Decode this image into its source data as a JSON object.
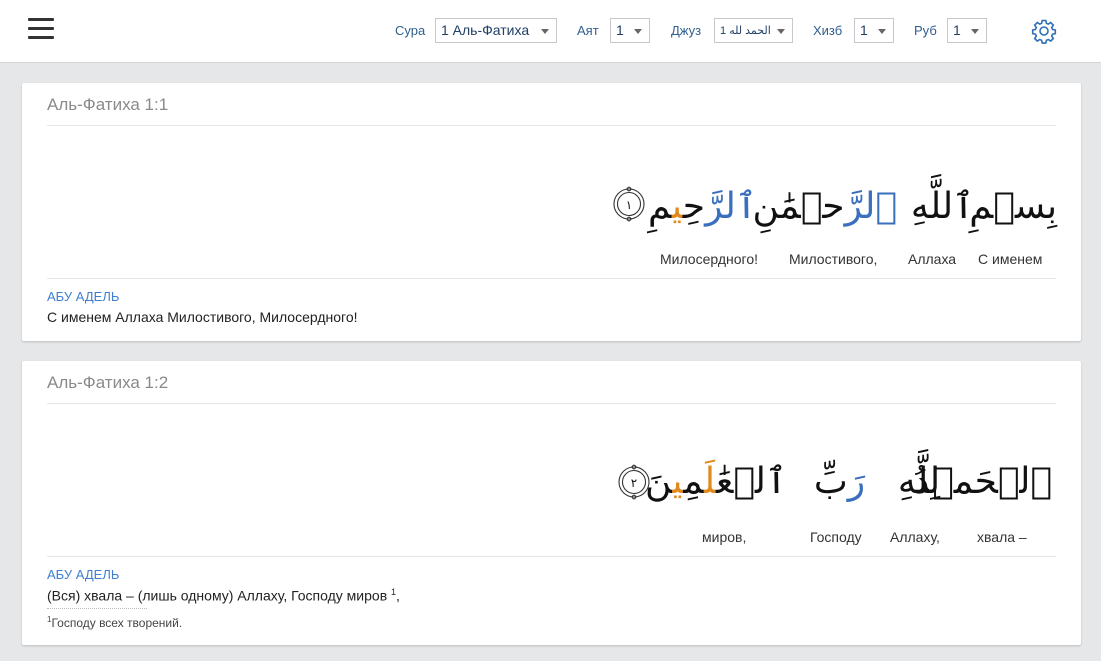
{
  "header": {
    "surah_label": "Сура",
    "surah_value": "1 Аль-Фатиха",
    "ayah_label": "Аят",
    "ayah_value": "1",
    "juz_label": "Джуз",
    "juz_value": "1 الحمد لله",
    "hizb_label": "Хизб",
    "hizb_value": "1",
    "rub_label": "Руб",
    "rub_value": "1",
    "icons": {
      "menu": "hamburger-menu-icon",
      "settings": "gear-icon"
    }
  },
  "verses": [
    {
      "title": "Аль-Фатиха 1:1",
      "ayah_number": "١",
      "words": [
        {
          "ar": "بِسۡمِ",
          "tr": "С именем"
        },
        {
          "ar": "ٱللَّهِ",
          "tr": "Аллаха"
        },
        {
          "ar": "ٱلرَّحۡمَٰنِ",
          "tr": "Милостивого,"
        },
        {
          "ar": "ٱلرَّحِيمِ",
          "tr": "Милосердного!"
        }
      ],
      "translator": "Абу Адель",
      "translation": "С именем Аллаха Милостивого, Милосердного!"
    },
    {
      "title": "Аль-Фатиха 1:2",
      "ayah_number": "٢",
      "words": [
        {
          "ar": "ٱلۡحَمۡدُ",
          "tr": "хвала –"
        },
        {
          "ar": "لِلَّهِ",
          "tr": "Аллаху,"
        },
        {
          "ar": "رَبِّ",
          "tr": "Господу"
        },
        {
          "ar": "ٱلۡعَٰلَمِينَ",
          "tr": "миров,"
        }
      ],
      "translator": "Абу Адель",
      "translation": "(Вся) хвала – (лишь одному) Аллаху, Господу миров",
      "translation_fn_mark": "1",
      "translation_tail": ",",
      "footnote_mark": "1",
      "footnote": "Господу всех творений."
    }
  ],
  "colors": {
    "link": "#3f7fd1",
    "title": "#8a8a8a",
    "tajweed_blue": "#3a6fbd",
    "tajweed_orange": "#e08a1e"
  }
}
